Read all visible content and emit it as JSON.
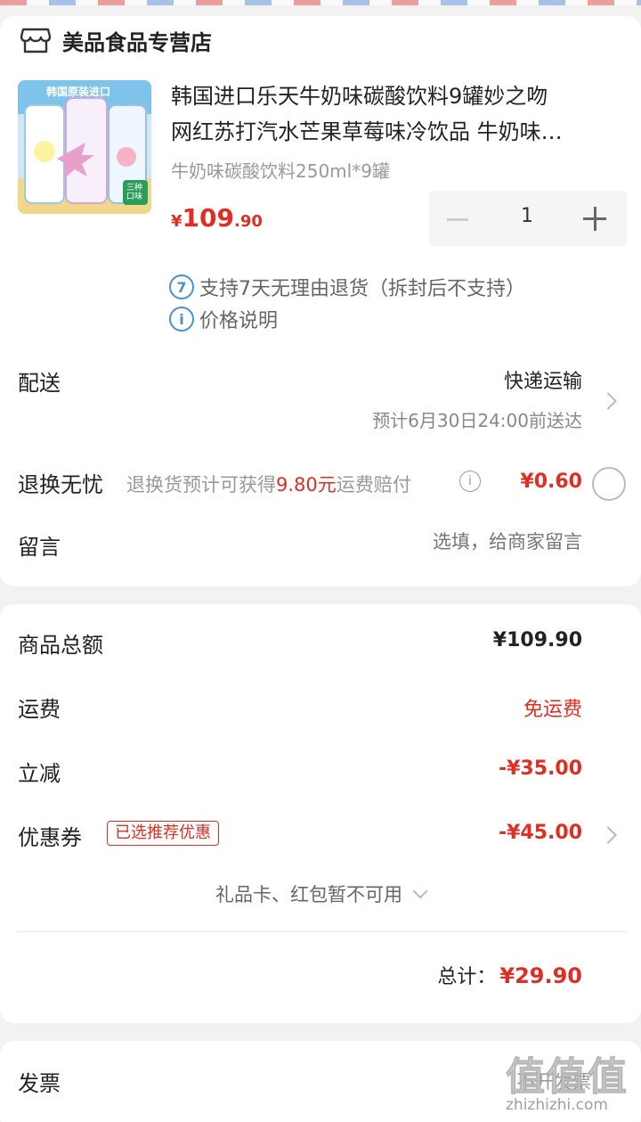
{
  "store": {
    "name": "美品食品专营店",
    "icon": "shop-icon"
  },
  "product": {
    "title_line1": "韩国进口乐天牛奶味碳酸饮料9罐妙之吻",
    "title_line2": "网红苏打汽水芒果草莓味冷饮品 牛奶味…",
    "image_text": "韩国原装进口",
    "image_badge": "三种口味",
    "spec": "牛奶味碳酸饮料250ml*9罐",
    "price_currency": "¥",
    "price_int": "109",
    "price_dec": ".90",
    "quantity": "1",
    "return_badge": "7",
    "return_text": "支持7天无理由退货（拆封后不支持）",
    "price_note": "价格说明"
  },
  "delivery": {
    "label": "配送",
    "type": "快递运输",
    "eta": "预计6月30日24:00前送达"
  },
  "worry_free": {
    "label": "退换无忧",
    "desc_prefix": "退换货预计可获得",
    "desc_amount": "9.80元",
    "desc_suffix": "运费赔付",
    "price": "¥0.60"
  },
  "message": {
    "label": "留言",
    "placeholder": "选填，给商家留言"
  },
  "summary": {
    "goods_label": "商品总额",
    "goods_value": "¥109.90",
    "shipping_label": "运费",
    "shipping_value": "免运费",
    "discount_label": "立减",
    "discount_value": "-¥35.00",
    "coupon_label": "优惠券",
    "coupon_tag": "已选推荐优惠",
    "coupon_value": "-¥45.00",
    "giftcard_text": "礼品卡、红包暂不可用",
    "total_label": "总计：",
    "total_value": "¥29.90"
  },
  "invoice": {
    "label": "发票",
    "value": "不开发票"
  },
  "watermark": {
    "glyphs": "值值值",
    "url": "zhizhizhi.com"
  },
  "colors": {
    "accent_red": "#e02e24",
    "info_blue": "#4a90d9"
  }
}
